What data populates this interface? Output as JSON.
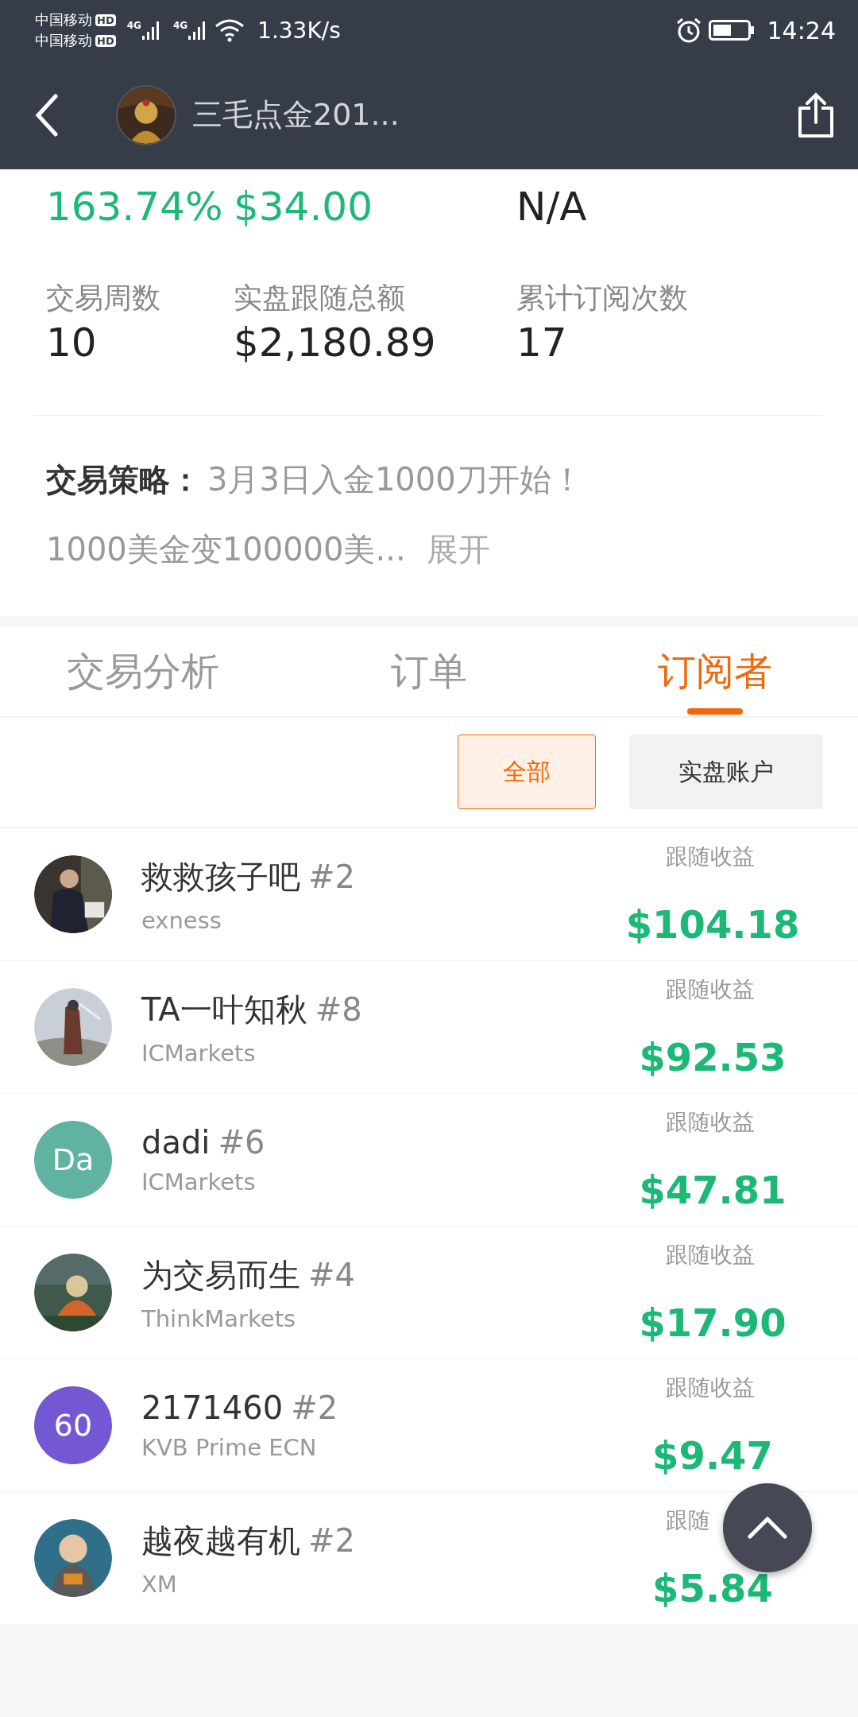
{
  "status_bar": {
    "carriers": [
      "中国移动",
      "中国移动"
    ],
    "hd_badges": [
      "HD",
      "HD"
    ],
    "network": [
      "4G",
      "4G"
    ],
    "speed": "1.33K/s",
    "time": "14:24"
  },
  "header": {
    "title": "三毛点金201..."
  },
  "summary": {
    "top_values": [
      {
        "value": "163.74%",
        "positive": true
      },
      {
        "value": "$34.00",
        "positive": true
      },
      {
        "value": "N/A",
        "positive": false
      }
    ],
    "stats": [
      {
        "label": "交易周数",
        "value": "10"
      },
      {
        "label": "实盘跟随总额",
        "value": "$2,180.89"
      },
      {
        "label": "累计订阅次数",
        "value": "17"
      }
    ],
    "strategy": {
      "label": "交易策略：",
      "line_1": "3月3日入金1000刀开始！",
      "line_2": "1000美金变100000美...",
      "expand": "展开"
    }
  },
  "tabs": [
    {
      "label": "交易分析",
      "selected": false
    },
    {
      "label": "订单",
      "selected": false
    },
    {
      "label": "订阅者",
      "selected": true
    }
  ],
  "filters": [
    {
      "label": "全部",
      "selected": true
    },
    {
      "label": "实盘账户",
      "selected": false
    }
  ],
  "subscribers": [
    {
      "name": "救救孩子吧",
      "rank": "#2",
      "broker": "exness",
      "profit_label": "跟随收益",
      "profit": "$104.18"
    },
    {
      "name": "TA一叶知秋",
      "rank": "#8",
      "broker": "ICMarkets",
      "profit_label": "跟随收益",
      "profit": "$92.53"
    },
    {
      "name": "dadi",
      "rank": "#6",
      "broker": "ICMarkets",
      "profit_label": "跟随收益",
      "profit": "$47.81",
      "avatar": {
        "kind": "initials",
        "text": "Da",
        "color": "#5fb3a0"
      }
    },
    {
      "name": "为交易而生",
      "rank": "#4",
      "broker": "ThinkMarkets",
      "profit_label": "跟随收益",
      "profit": "$17.90"
    },
    {
      "name": "2171460",
      "rank": "#2",
      "broker": "KVB Prime ECN",
      "profit_label": "跟随收益",
      "profit": "$9.47",
      "avatar": {
        "kind": "initials",
        "text": "60",
        "color": "#7357d3"
      }
    },
    {
      "name": "越夜越有机",
      "rank": "#2",
      "broker": "XM",
      "profit_label": "跟随",
      "profit": "$5.84"
    }
  ]
}
